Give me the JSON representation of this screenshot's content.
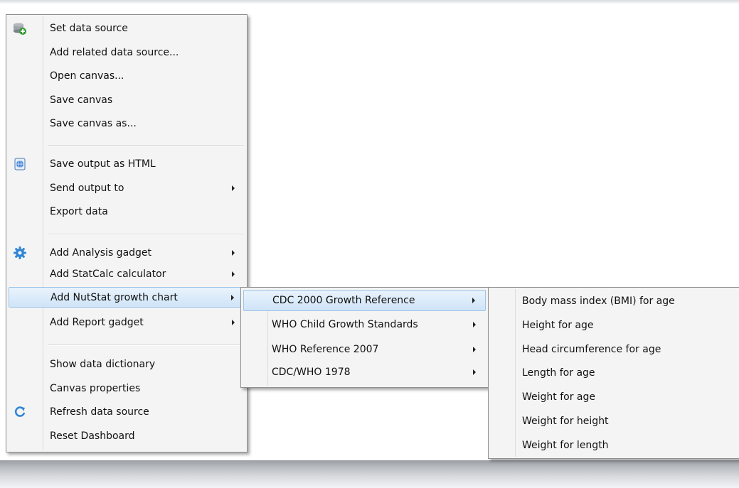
{
  "main_menu": {
    "items": [
      {
        "label": "Set data source",
        "icon": "database-add-icon",
        "submenu": false
      },
      {
        "label": "Add related data source...",
        "submenu": false
      },
      {
        "label": "Open canvas...",
        "submenu": false
      },
      {
        "label": "Save canvas",
        "submenu": false
      },
      {
        "label": "Save canvas as...",
        "submenu": false
      },
      {
        "label": "Save output as HTML",
        "icon": "globe-html-icon",
        "submenu": false
      },
      {
        "label": "Send output to",
        "submenu": true
      },
      {
        "label": "Export data",
        "submenu": false
      },
      {
        "label": "Add Analysis gadget",
        "icon": "gear-icon",
        "submenu": true
      },
      {
        "label": "Add StatCalc calculator",
        "submenu": true
      },
      {
        "label": "Add NutStat growth chart",
        "submenu": true,
        "highlighted": true
      },
      {
        "label": "Add Report gadget",
        "submenu": true
      },
      {
        "label": "Show data dictionary",
        "submenu": false
      },
      {
        "label": "Canvas properties",
        "submenu": false
      },
      {
        "label": "Refresh data source",
        "icon": "refresh-icon",
        "submenu": false
      },
      {
        "label": "Reset Dashboard",
        "submenu": false
      }
    ]
  },
  "growth_menu": {
    "items": [
      {
        "label": "CDC 2000 Growth Reference",
        "submenu": true,
        "highlighted": true
      },
      {
        "label": "WHO Child Growth Standards",
        "submenu": true
      },
      {
        "label": "WHO Reference 2007",
        "submenu": true
      },
      {
        "label": "CDC/WHO 1978",
        "submenu": true
      }
    ]
  },
  "cdc_menu": {
    "items": [
      {
        "label": "Body mass index (BMI) for age"
      },
      {
        "label": "Height for age"
      },
      {
        "label": "Head circumference for age"
      },
      {
        "label": "Length for age"
      },
      {
        "label": "Weight for age"
      },
      {
        "label": "Weight for height"
      },
      {
        "label": "Weight for length"
      }
    ]
  },
  "colors": {
    "highlight_bg": "#d6e8f9",
    "highlight_border": "#9cc3e8",
    "menu_bg": "#f4f4f4"
  }
}
